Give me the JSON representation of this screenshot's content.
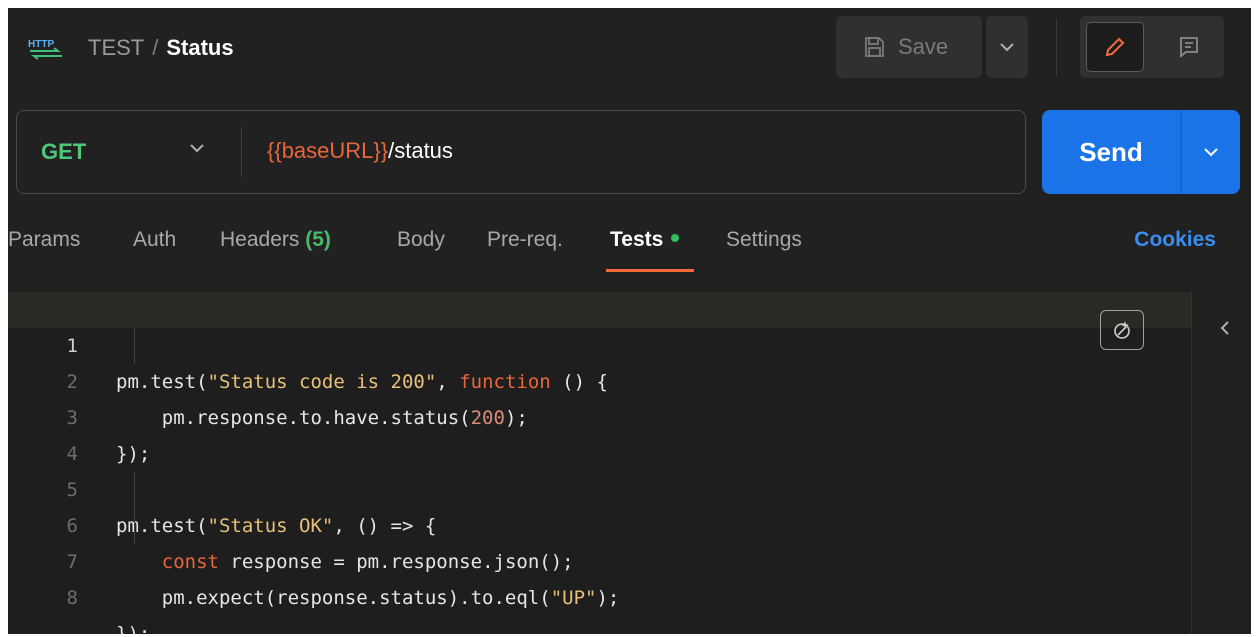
{
  "header": {
    "protocol_icon": "http-icon",
    "collection": "TEST",
    "separator": "/",
    "request_name": "Status",
    "save_label": "Save"
  },
  "request": {
    "method": "GET",
    "url_variable": "{{baseURL}}",
    "url_path": "/status",
    "send_label": "Send"
  },
  "tabs": {
    "params": "Params",
    "auth": "Auth",
    "headers": "Headers",
    "headers_count": "(5)",
    "body": "Body",
    "prereq": "Pre-req.",
    "tests": "Tests",
    "settings": "Settings",
    "active": "Tests"
  },
  "cookies_label": "Cookies",
  "editor": {
    "line_numbers": [
      "1",
      "2",
      "3",
      "4",
      "5",
      "6",
      "7",
      "8"
    ],
    "current_line": 1
  },
  "colors": {
    "accent": "#f26b3a",
    "send": "#1a74e8",
    "method": "#4ec77a",
    "link": "#3a8df0"
  }
}
